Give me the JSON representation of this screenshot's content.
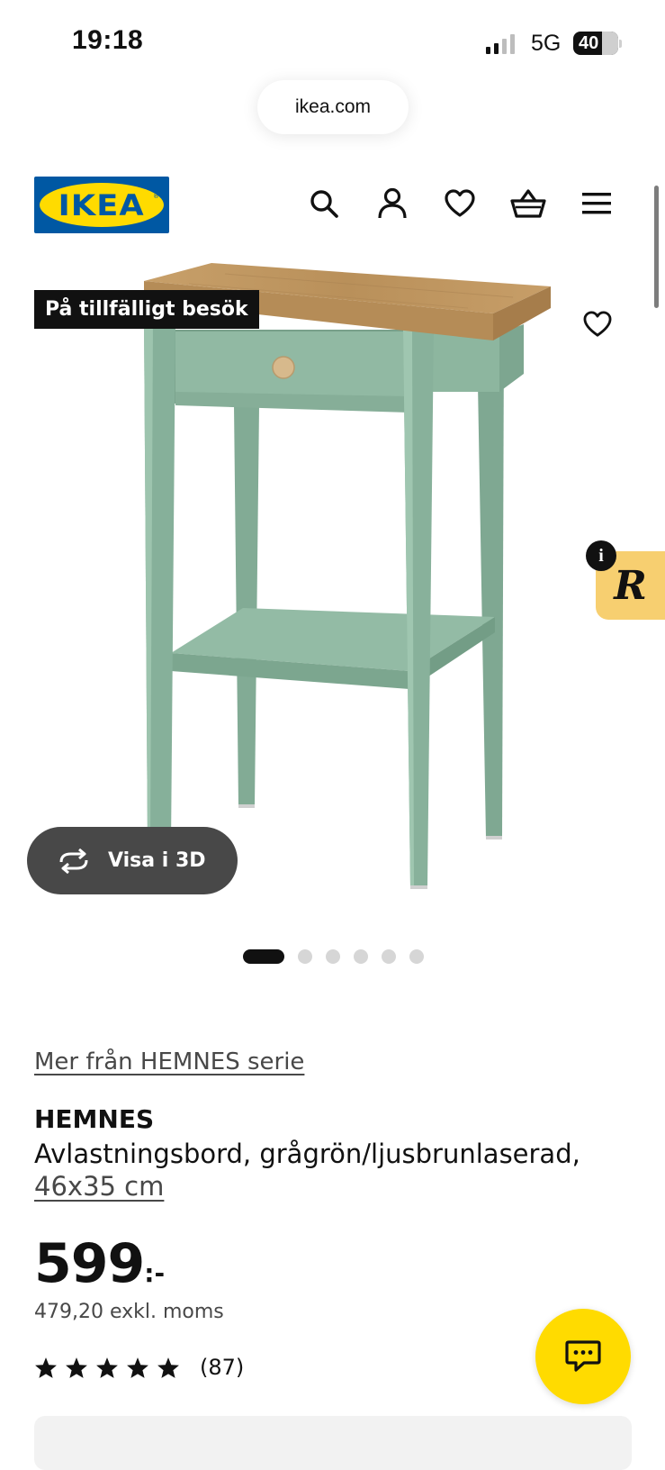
{
  "status_bar": {
    "time": "19:18",
    "network": "5G",
    "battery": "40"
  },
  "browser": {
    "url": "ikea.com"
  },
  "header": {
    "logo_text": "IKEA",
    "icons": [
      "search-icon",
      "account-icon",
      "heart-icon",
      "basket-icon",
      "menu-icon"
    ]
  },
  "product_image": {
    "badge": "På tillfälligt besök",
    "view_3d_label": "Visa i 3D",
    "carousel": {
      "total": 6,
      "active": 1
    },
    "widget_letter": "R",
    "widget_info": "i"
  },
  "product": {
    "series_link": "Mer från HEMNES serie",
    "name": "HEMNES",
    "description": "Avlastningsbord, grågrön/ljusbrunlaserad,",
    "size": "46x35 cm",
    "price": "599",
    "price_suffix": ":-",
    "price_excl_vat": "479,20 exkl. moms",
    "rating_stars": 5,
    "review_count": "(87)"
  },
  "colors": {
    "ikea_blue": "#0058a3",
    "ikea_yellow": "#ffdb00",
    "table_green": "#8fb8a1",
    "table_top": "#c49a63",
    "widget_bg": "#f7cf70"
  }
}
